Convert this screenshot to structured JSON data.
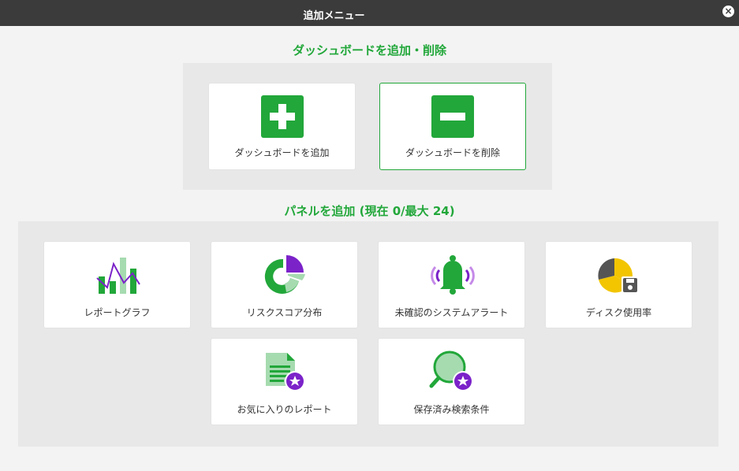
{
  "window": {
    "title": "追加メニュー",
    "close_icon": "×"
  },
  "dashboard_section": {
    "title": "ダッシュボードを追加・削除",
    "cards": [
      {
        "label": "ダッシュボードを追加",
        "icon": "plus-square-icon"
      },
      {
        "label": "ダッシュボードを削除",
        "icon": "minus-square-icon"
      }
    ]
  },
  "panel_section": {
    "title": "パネルを追加 (現在 0/最大 24)",
    "cards": [
      {
        "label": "レポートグラフ",
        "icon": "bar-line-chart-icon"
      },
      {
        "label": "リスクスコア分布",
        "icon": "donut-chart-icon"
      },
      {
        "label": "未確認のシステムアラート",
        "icon": "bell-alert-icon"
      },
      {
        "label": "ディスク使用率",
        "icon": "disk-pie-icon"
      },
      {
        "label": "お気に入りのレポート",
        "icon": "favorite-report-icon"
      },
      {
        "label": "保存済み検索条件",
        "icon": "saved-search-icon"
      }
    ]
  },
  "colors": {
    "accent_green": "#22a73a",
    "light_green": "#a6dbb0",
    "purple": "#7b22c9",
    "yellow": "#f2c500",
    "gray_dark": "#555555",
    "titlebar": "#3b3b3b"
  }
}
